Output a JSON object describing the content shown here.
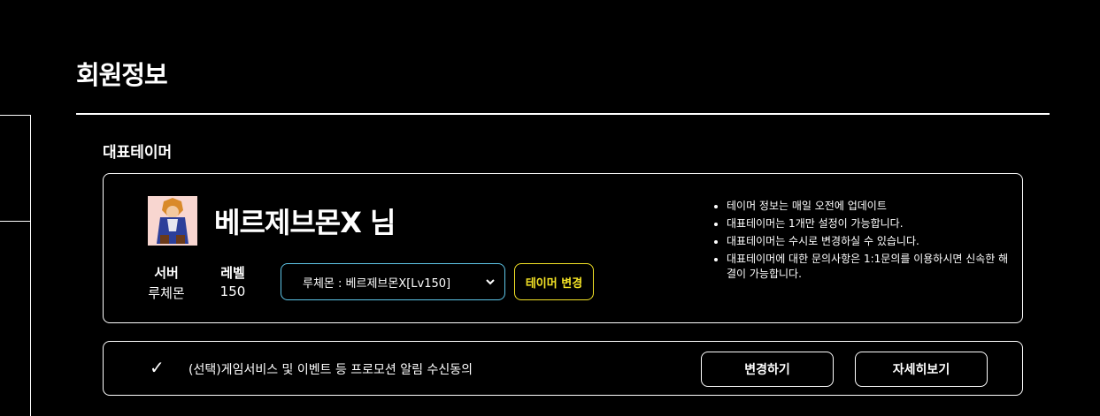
{
  "page": {
    "title": "회원정보"
  },
  "section": {
    "title": "대표테이머"
  },
  "profile": {
    "name": "베르제브몬X 님",
    "server_label": "서버",
    "server_value": "루체몬",
    "level_label": "레벨",
    "level_value": "150",
    "select_value": "루체몬 : 베르제브몬X[Lv150]",
    "change_button": "테이머 변경",
    "avatar_icon": "character-avatar-icon"
  },
  "notes": [
    "테이머 정보는 매일 오전에 업데이트",
    "대표테이머는 1개만 설정이 가능합니다.",
    "대표테이머는 수시로 변경하실 수 있습니다.",
    "대표테이머에 대한 문의사항은 1:1문의를 이용하시면 신속한 해결이 가능합니다."
  ],
  "consent": {
    "check_icon": "check-icon",
    "text": "(선택)게임서비스 및 이벤트 등 프로모션 알림 수신동의",
    "modify_button": "변경하기",
    "detail_button": "자세히보기"
  },
  "colors": {
    "background": "#000000",
    "select_border": "#5ec6e8",
    "tamer_button": "#f4e326"
  }
}
